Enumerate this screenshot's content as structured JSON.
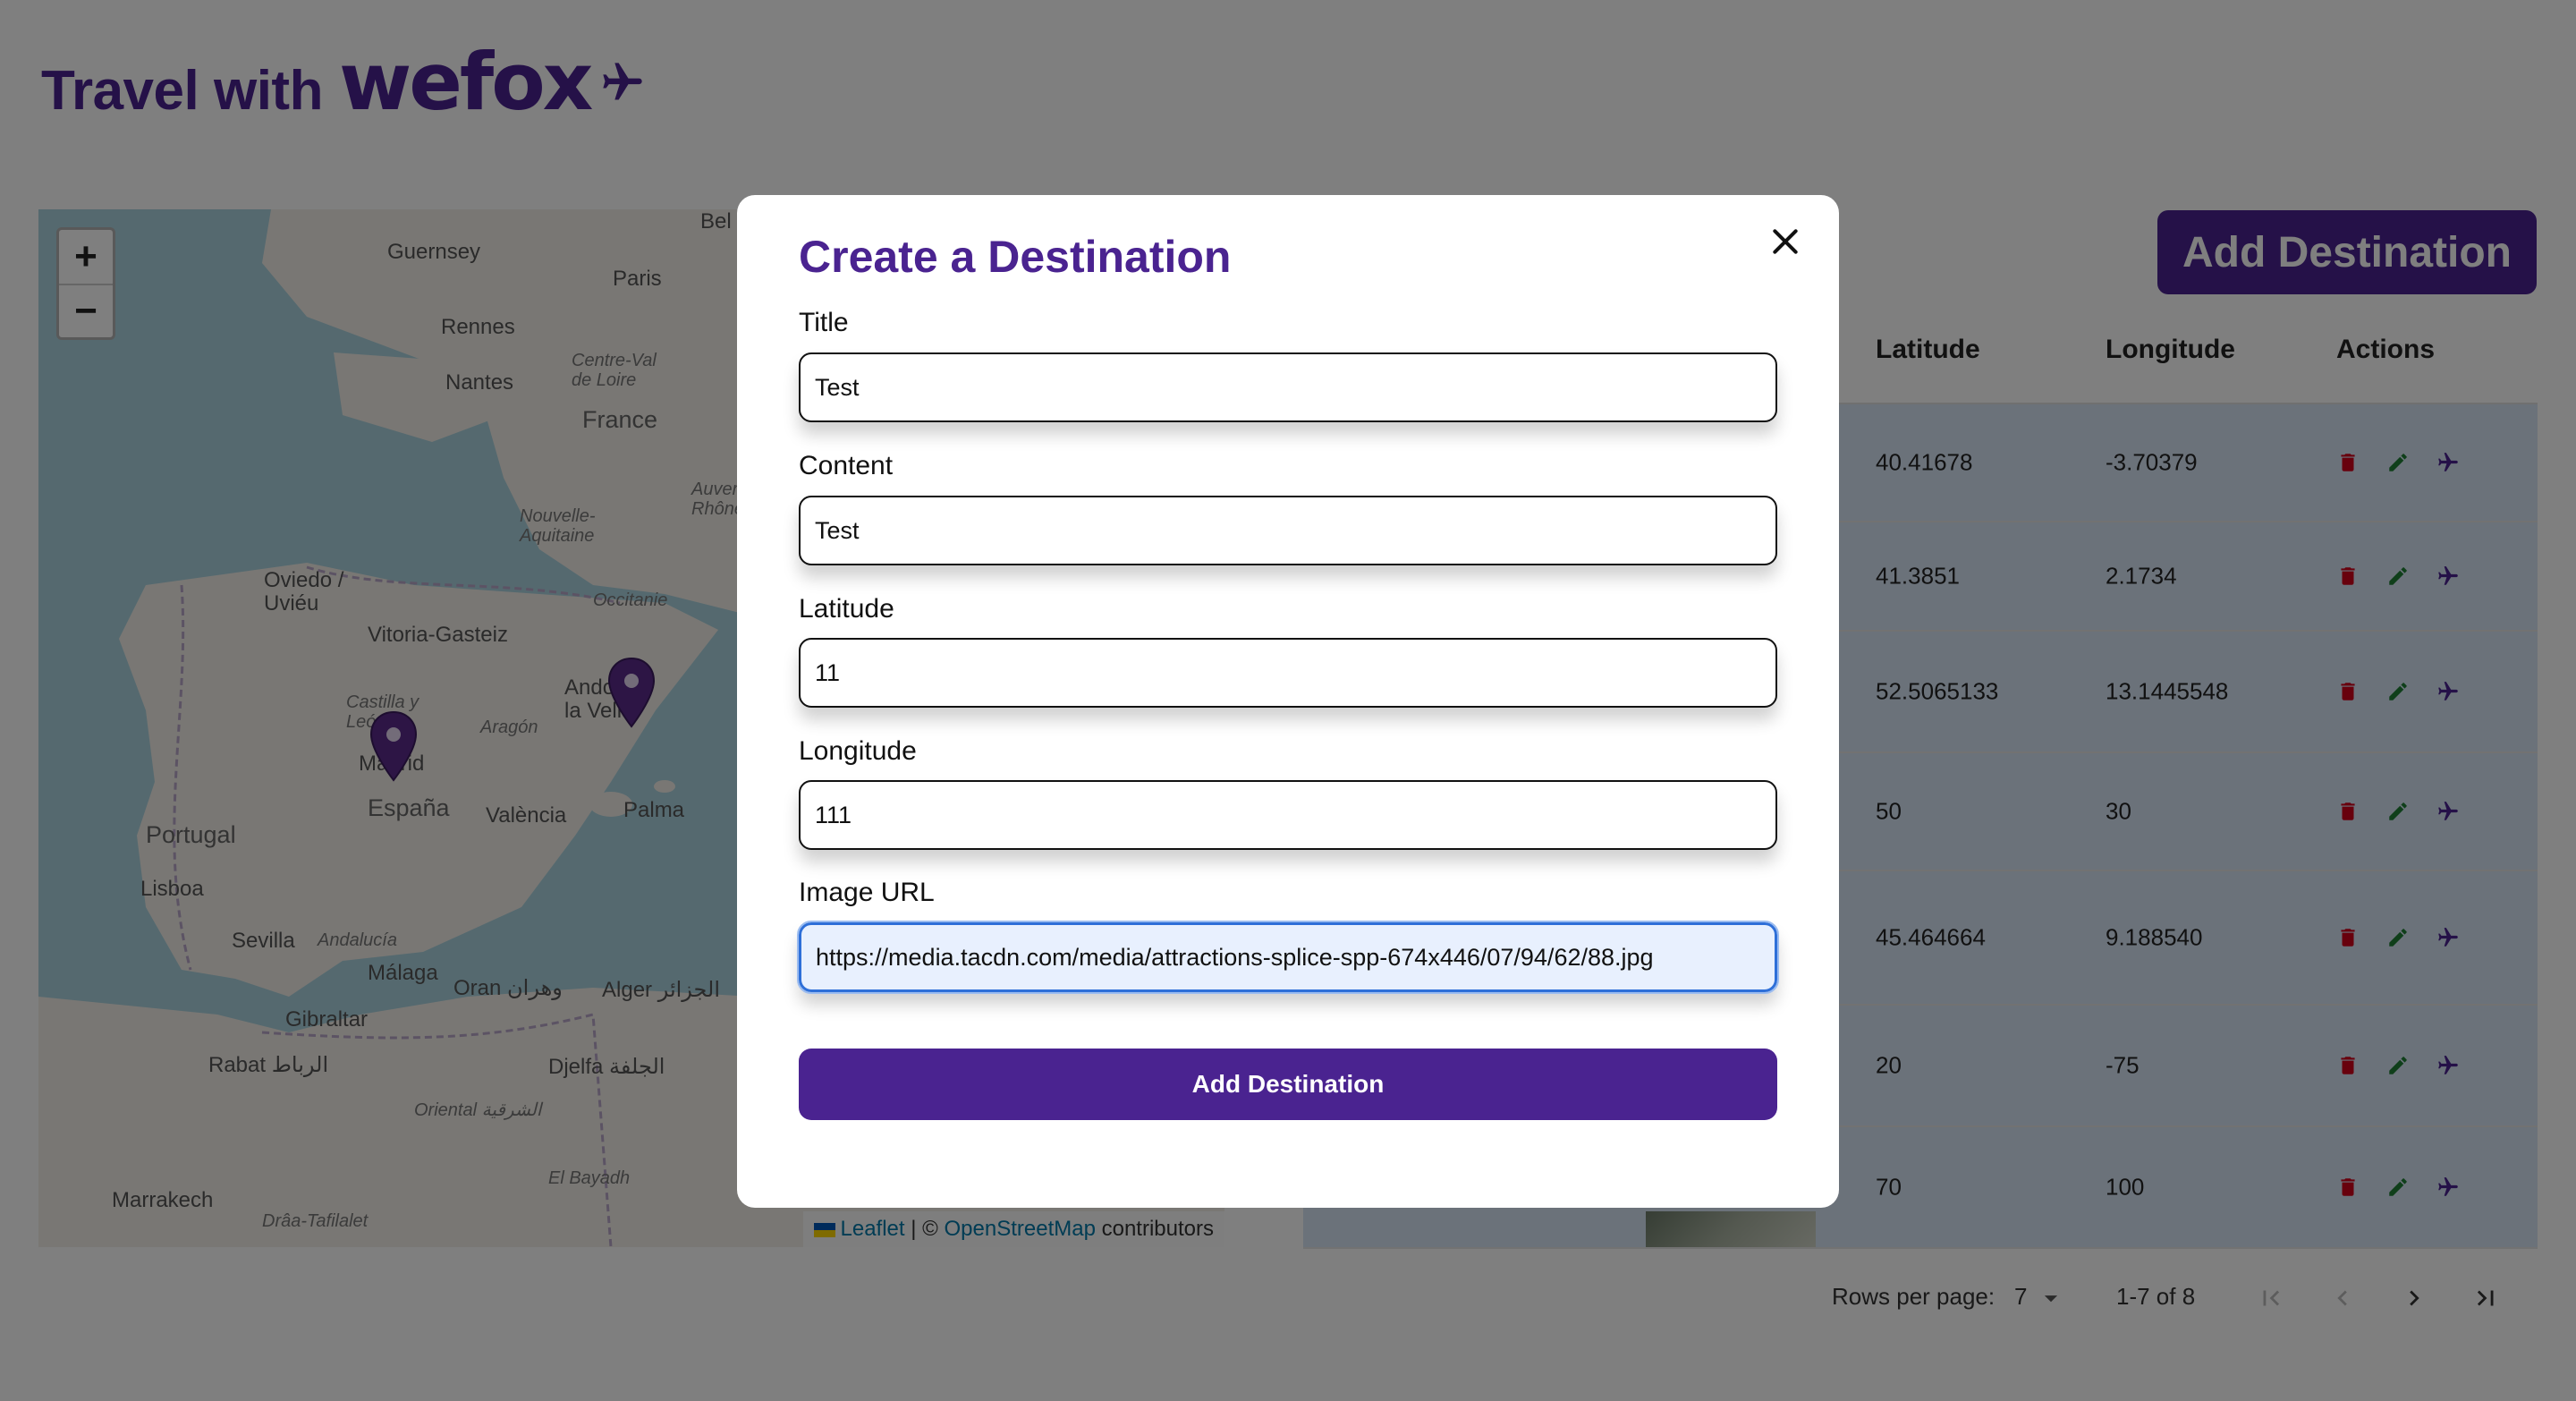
{
  "header": {
    "brand_text": "Travel with",
    "brand_logo": "wefox",
    "brand_icon": "plane-icon"
  },
  "map": {
    "zoom_in": "+",
    "zoom_out": "−",
    "labels": [
      "Guernsey",
      "Paris",
      "Rennes",
      "Nantes",
      "Centre-Val de Loire",
      "France",
      "Nouvelle-Aquitaine",
      "Occitanie",
      "Oviedo / Uviéu",
      "Vitoria-Gasteiz",
      "Castilla y León",
      "Aragón",
      "Madrid",
      "España",
      "València",
      "Palma",
      "Portugal",
      "Lisboa",
      "Sevilla",
      "Andalucía",
      "Málaga",
      "Gibraltar",
      "Oran وهران",
      "Alger الجزائر",
      "Rabat الرباط",
      "Djelfa الجلفة",
      "Oriental الشرقية",
      "Marrakech",
      "El Bayadh",
      "Drâa-Tafilalet",
      "Andorra la Vella",
      "Auvergne-Rhône",
      "Bel"
    ],
    "attribution": {
      "leaflet": "Leaflet",
      "sep": " | © ",
      "osm": "OpenStreetMap",
      "tail": " contributors"
    },
    "marker_icon": "map-pin-icon"
  },
  "toolbar": {
    "add_button": "Add Destination"
  },
  "table": {
    "columns": [
      "Latitude",
      "Longitude",
      "Actions"
    ],
    "rows": [
      {
        "latitude": "40.41678",
        "longitude": "-3.70379"
      },
      {
        "latitude": "41.3851",
        "longitude": "2.1734"
      },
      {
        "latitude": "52.5065133",
        "longitude": "13.1445548"
      },
      {
        "latitude": "50",
        "longitude": "30"
      },
      {
        "latitude": "45.464664",
        "longitude": "9.188540"
      },
      {
        "latitude": "20",
        "longitude": "-75"
      },
      {
        "latitude": "70",
        "longitude": "100"
      }
    ],
    "action_icons": [
      "trash-icon",
      "pencil-icon",
      "plane-icon"
    ],
    "colors": {
      "delete": "#d0021b",
      "edit": "#1e7e34",
      "fly": "#4a2390"
    }
  },
  "pagination": {
    "rows_label": "Rows per page:",
    "rows_value": "7",
    "range": "1-7 of 8"
  },
  "modal": {
    "title": "Create a Destination",
    "close_icon": "close-icon",
    "fields": {
      "title": {
        "label": "Title",
        "value": "Test"
      },
      "content": {
        "label": "Content",
        "value": "Test"
      },
      "latitude": {
        "label": "Latitude",
        "value": "11"
      },
      "longitude": {
        "label": "Longitude",
        "value": "111"
      },
      "image_url": {
        "label": "Image URL",
        "value": "https://media.tacdn.com/media/attractions-splice-spp-674x446/07/94/62/88.jpg"
      }
    },
    "submit_label": "Add Destination"
  },
  "colors": {
    "brand": "#4a2390",
    "overlay": "rgba(0,0,0,0.5)"
  }
}
